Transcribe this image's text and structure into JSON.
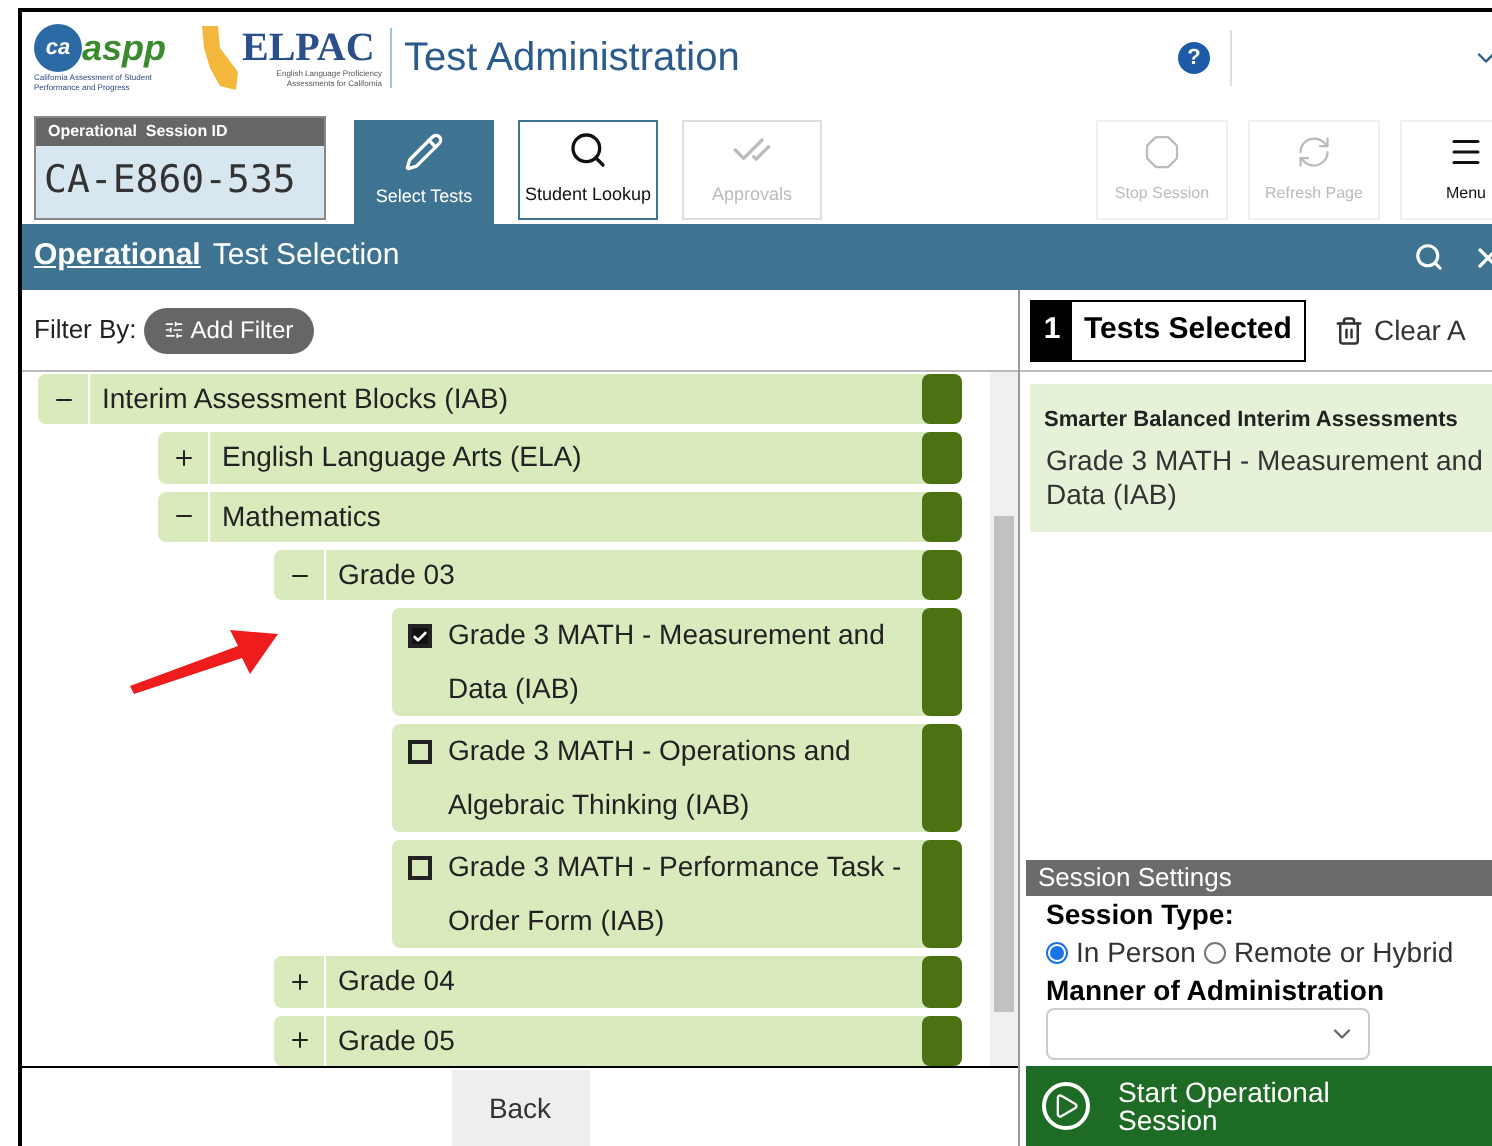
{
  "header": {
    "logo_mark": "ca",
    "logo_word": "aspp",
    "logo_caption": "California Assessment of Student Performance and Progress",
    "elpac_word": "ELPAC",
    "elpac_caption": "English Language Proficiency Assessments for California",
    "title": "Test Administration",
    "help": "?"
  },
  "session_id": {
    "label": "Operational  Session ID",
    "value": "CA-E860-535"
  },
  "toolbar": [
    {
      "label": "Select Tests",
      "selected": true,
      "disabled": false
    },
    {
      "label": "Student Lookup",
      "selected": false,
      "disabled": false
    },
    {
      "label": "Approvals",
      "selected": false,
      "disabled": true
    }
  ],
  "actions": [
    {
      "label": "Stop Session",
      "disabled": true
    },
    {
      "label": "Refresh Page",
      "disabled": true
    },
    {
      "label": "Menu",
      "disabled": false
    }
  ],
  "breadcrumb": {
    "link": "Operational",
    "title": "Test Selection"
  },
  "filter": {
    "label": "Filter By:",
    "button": "Add Filter"
  },
  "tree": [
    {
      "kind": "group",
      "label": "Interim Assessment Blocks (IAB)",
      "expanded": true,
      "children": [
        {
          "kind": "group",
          "label": "English Language Arts (ELA)",
          "expanded": false
        },
        {
          "kind": "group",
          "label": "Mathematics",
          "expanded": true,
          "children": [
            {
              "kind": "group",
              "label": "Grade 03",
              "expanded": true,
              "children": [
                {
                  "kind": "test",
                  "label": "Grade 3 MATH - Measurement and Data (IAB)",
                  "checked": true
                },
                {
                  "kind": "test",
                  "label": "Grade 3 MATH - Operations and Algebraic Thinking (IAB)",
                  "checked": false
                },
                {
                  "kind": "test",
                  "label": "Grade 3 MATH - Performance Task - Order Form (IAB)",
                  "checked": false
                }
              ]
            },
            {
              "kind": "group",
              "label": "Grade 04",
              "expanded": false
            },
            {
              "kind": "group",
              "label": "Grade 05",
              "expanded": false
            }
          ]
        }
      ]
    }
  ],
  "back_button": "Back",
  "selected_panel": {
    "count": "1",
    "title": "Tests Selected",
    "clear": "Clear A",
    "group": "Smarter Balanced Interim Assessments",
    "items": [
      "Grade 3 MATH - Measurement and Data (IAB)"
    ]
  },
  "session_settings": {
    "title": "Session Settings",
    "type_label": "Session Type:",
    "types": [
      {
        "label": "In Person",
        "selected": true
      },
      {
        "label": "Remote or Hybrid",
        "selected": false
      }
    ],
    "manner_label": "Manner of Administration"
  },
  "start_button": "Start Operational Session"
}
